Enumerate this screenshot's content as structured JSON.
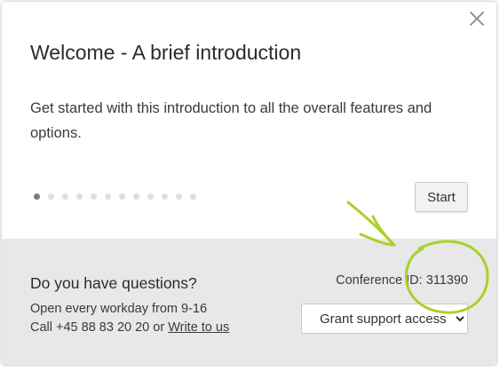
{
  "dialog": {
    "close_icon": "close-icon",
    "title": "Welcome - A brief introduction",
    "intro": "Get started with this introduction to all the overall features and options.",
    "pager": {
      "total_steps": 12,
      "current_step": 1
    },
    "start_label": "Start"
  },
  "footer": {
    "question": "Do you have questions?",
    "hours": "Open every workday from 9-16",
    "call_prefix": "Call +45 88 83 20 20 or ",
    "write_link": "Write to us",
    "conference_label": "Conference ID:",
    "conference_id": "311390",
    "grant_select": {
      "selected": "Grant support access"
    }
  },
  "annotation": {
    "color": "#a8d12a",
    "shapes": [
      "arrow",
      "circle"
    ]
  },
  "colors": {
    "footer_bg": "#e8e8e8",
    "active_dot": "#7a7a7a",
    "inactive_dot": "#dedede"
  }
}
